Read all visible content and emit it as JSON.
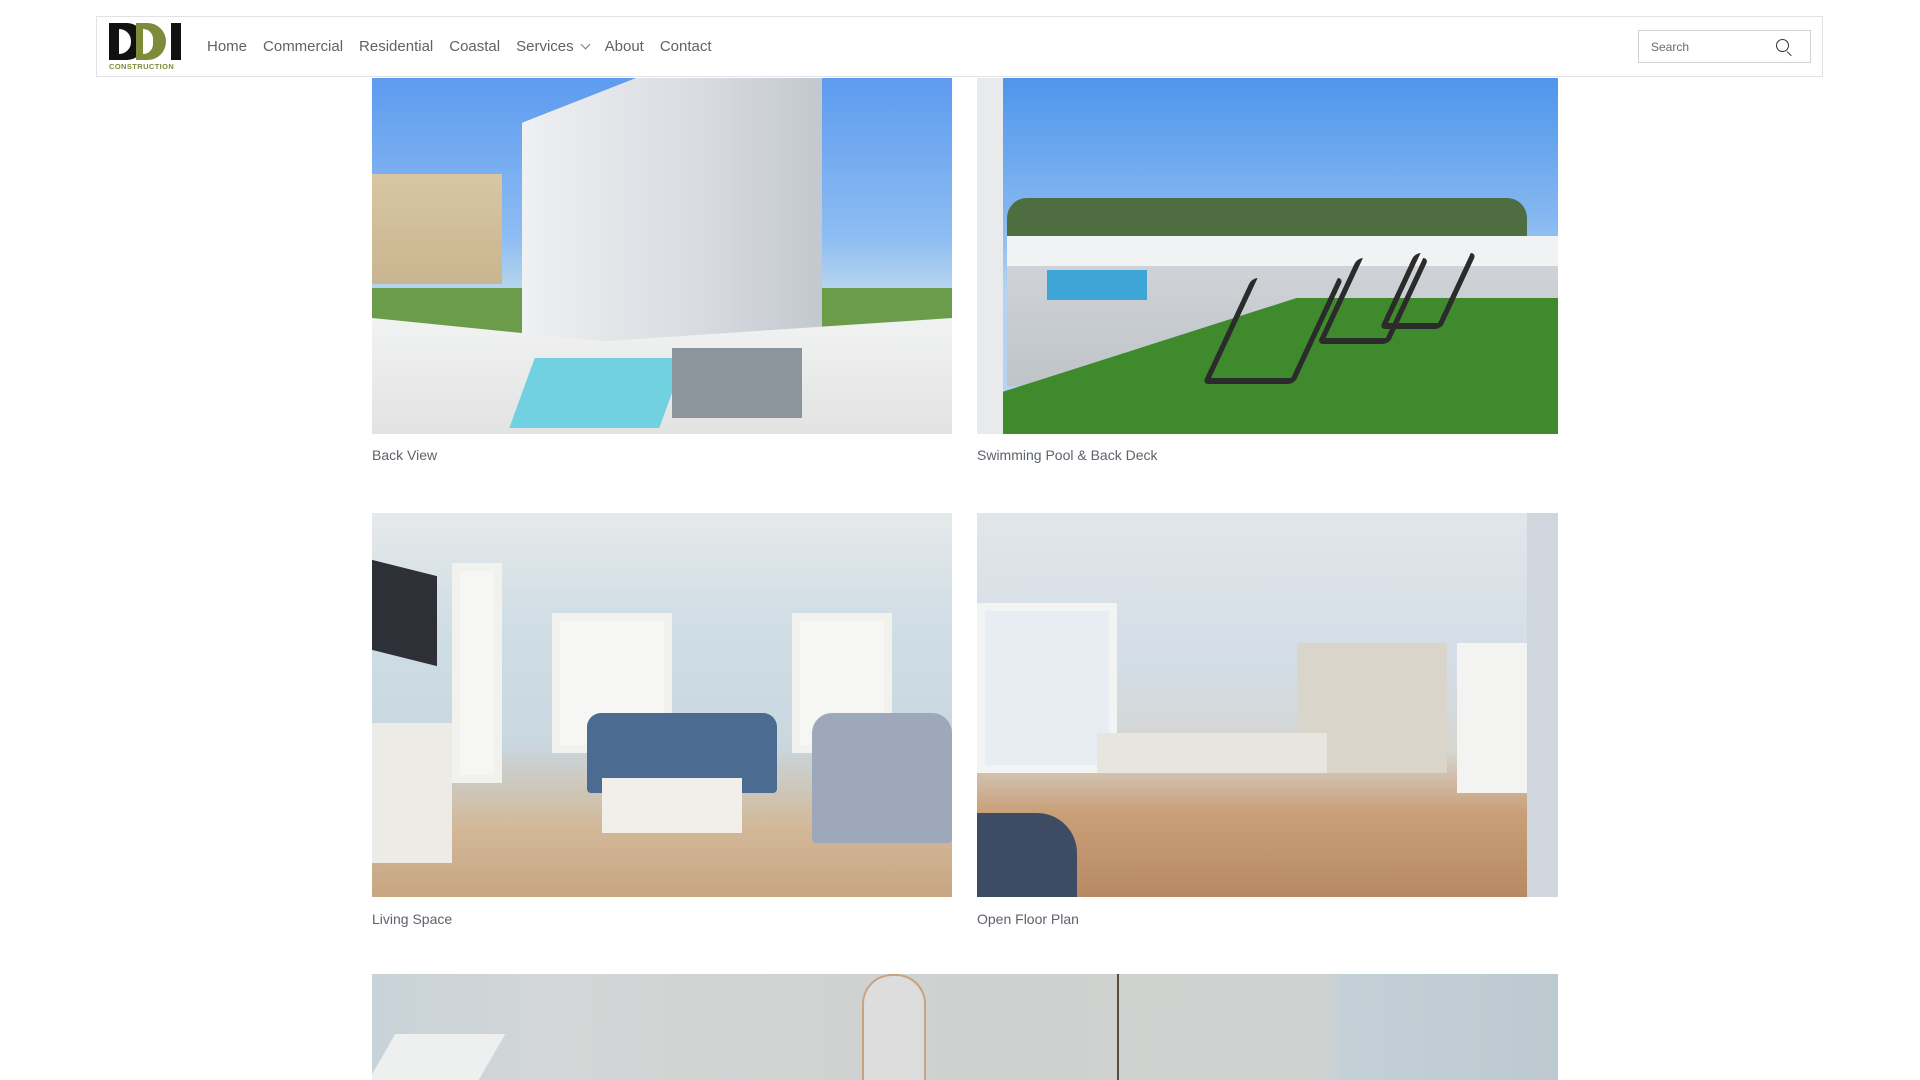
{
  "brand": {
    "logo_word": "CONSTRUCTION",
    "logo_letters": "DDI",
    "colors": {
      "dark": "#111111",
      "olive": "#7d8b3a"
    }
  },
  "nav": {
    "items": [
      {
        "label": "Home"
      },
      {
        "label": "Commercial"
      },
      {
        "label": "Residential"
      },
      {
        "label": "Coastal"
      },
      {
        "label": "Services",
        "has_dropdown": true
      },
      {
        "label": "About"
      },
      {
        "label": "Contact"
      }
    ]
  },
  "search": {
    "placeholder": "Search",
    "icon": "search-icon"
  },
  "gallery": {
    "items": [
      {
        "caption": "Back View"
      },
      {
        "caption": "Swimming Pool & Back Deck"
      },
      {
        "caption": "Living Space"
      },
      {
        "caption": "Open Floor Plan"
      },
      {
        "caption": ""
      }
    ]
  }
}
